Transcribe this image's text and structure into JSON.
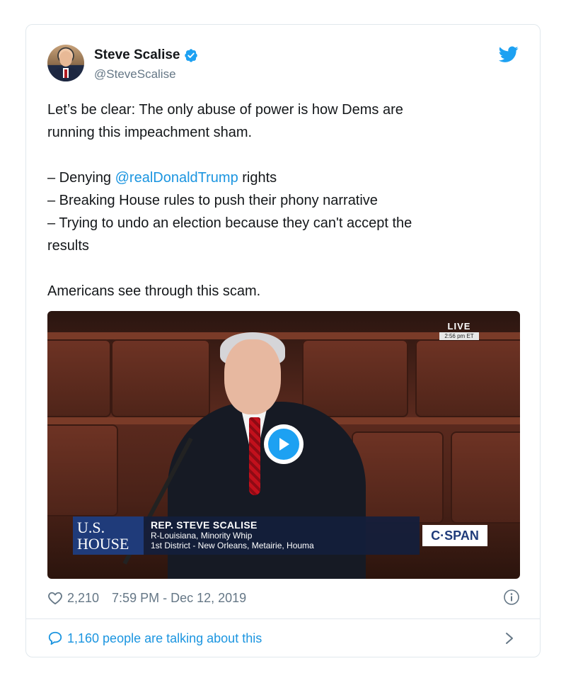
{
  "tweet": {
    "display_name": "Steve Scalise",
    "handle": "@SteveScalise",
    "text_line1": "Let’s be clear: The only abuse of power is how Dems are",
    "text_line2": "running this impeachment sham.",
    "bullet1_prefix": "– Denying ",
    "bullet1_mention": "@realDonaldTrump",
    "bullet1_suffix": " rights",
    "bullet2": "– Breaking House rules to push their phony narrative",
    "bullet3": "– Trying to undo an election because they can't accept the",
    "bullet3_cont": "results",
    "closing": "Americans see through this scam."
  },
  "video": {
    "live_label": "LIVE",
    "live_time": "2:56 pm ET",
    "house_line1": "U.S.",
    "house_line2": "HOUSE",
    "caption_name": "REP. STEVE SCALISE",
    "caption_line1": "R-Louisiana, Minority Whip",
    "caption_line2": "1st District - New Orleans, Metairie, Houma",
    "network": "C·SPAN"
  },
  "meta": {
    "likes": "2,210",
    "timestamp": "7:59 PM - Dec 12, 2019"
  },
  "footer": {
    "talking": "1,160 people are talking about this"
  },
  "colors": {
    "link": "#1b95e0",
    "verified": "#1da1f2",
    "secondary": "#657786",
    "border": "#e1e8ed"
  },
  "icons": [
    "verified-badge-icon",
    "twitter-bird-icon",
    "play-icon",
    "heart-icon",
    "info-icon",
    "speech-bubble-icon",
    "chevron-right-icon"
  ]
}
